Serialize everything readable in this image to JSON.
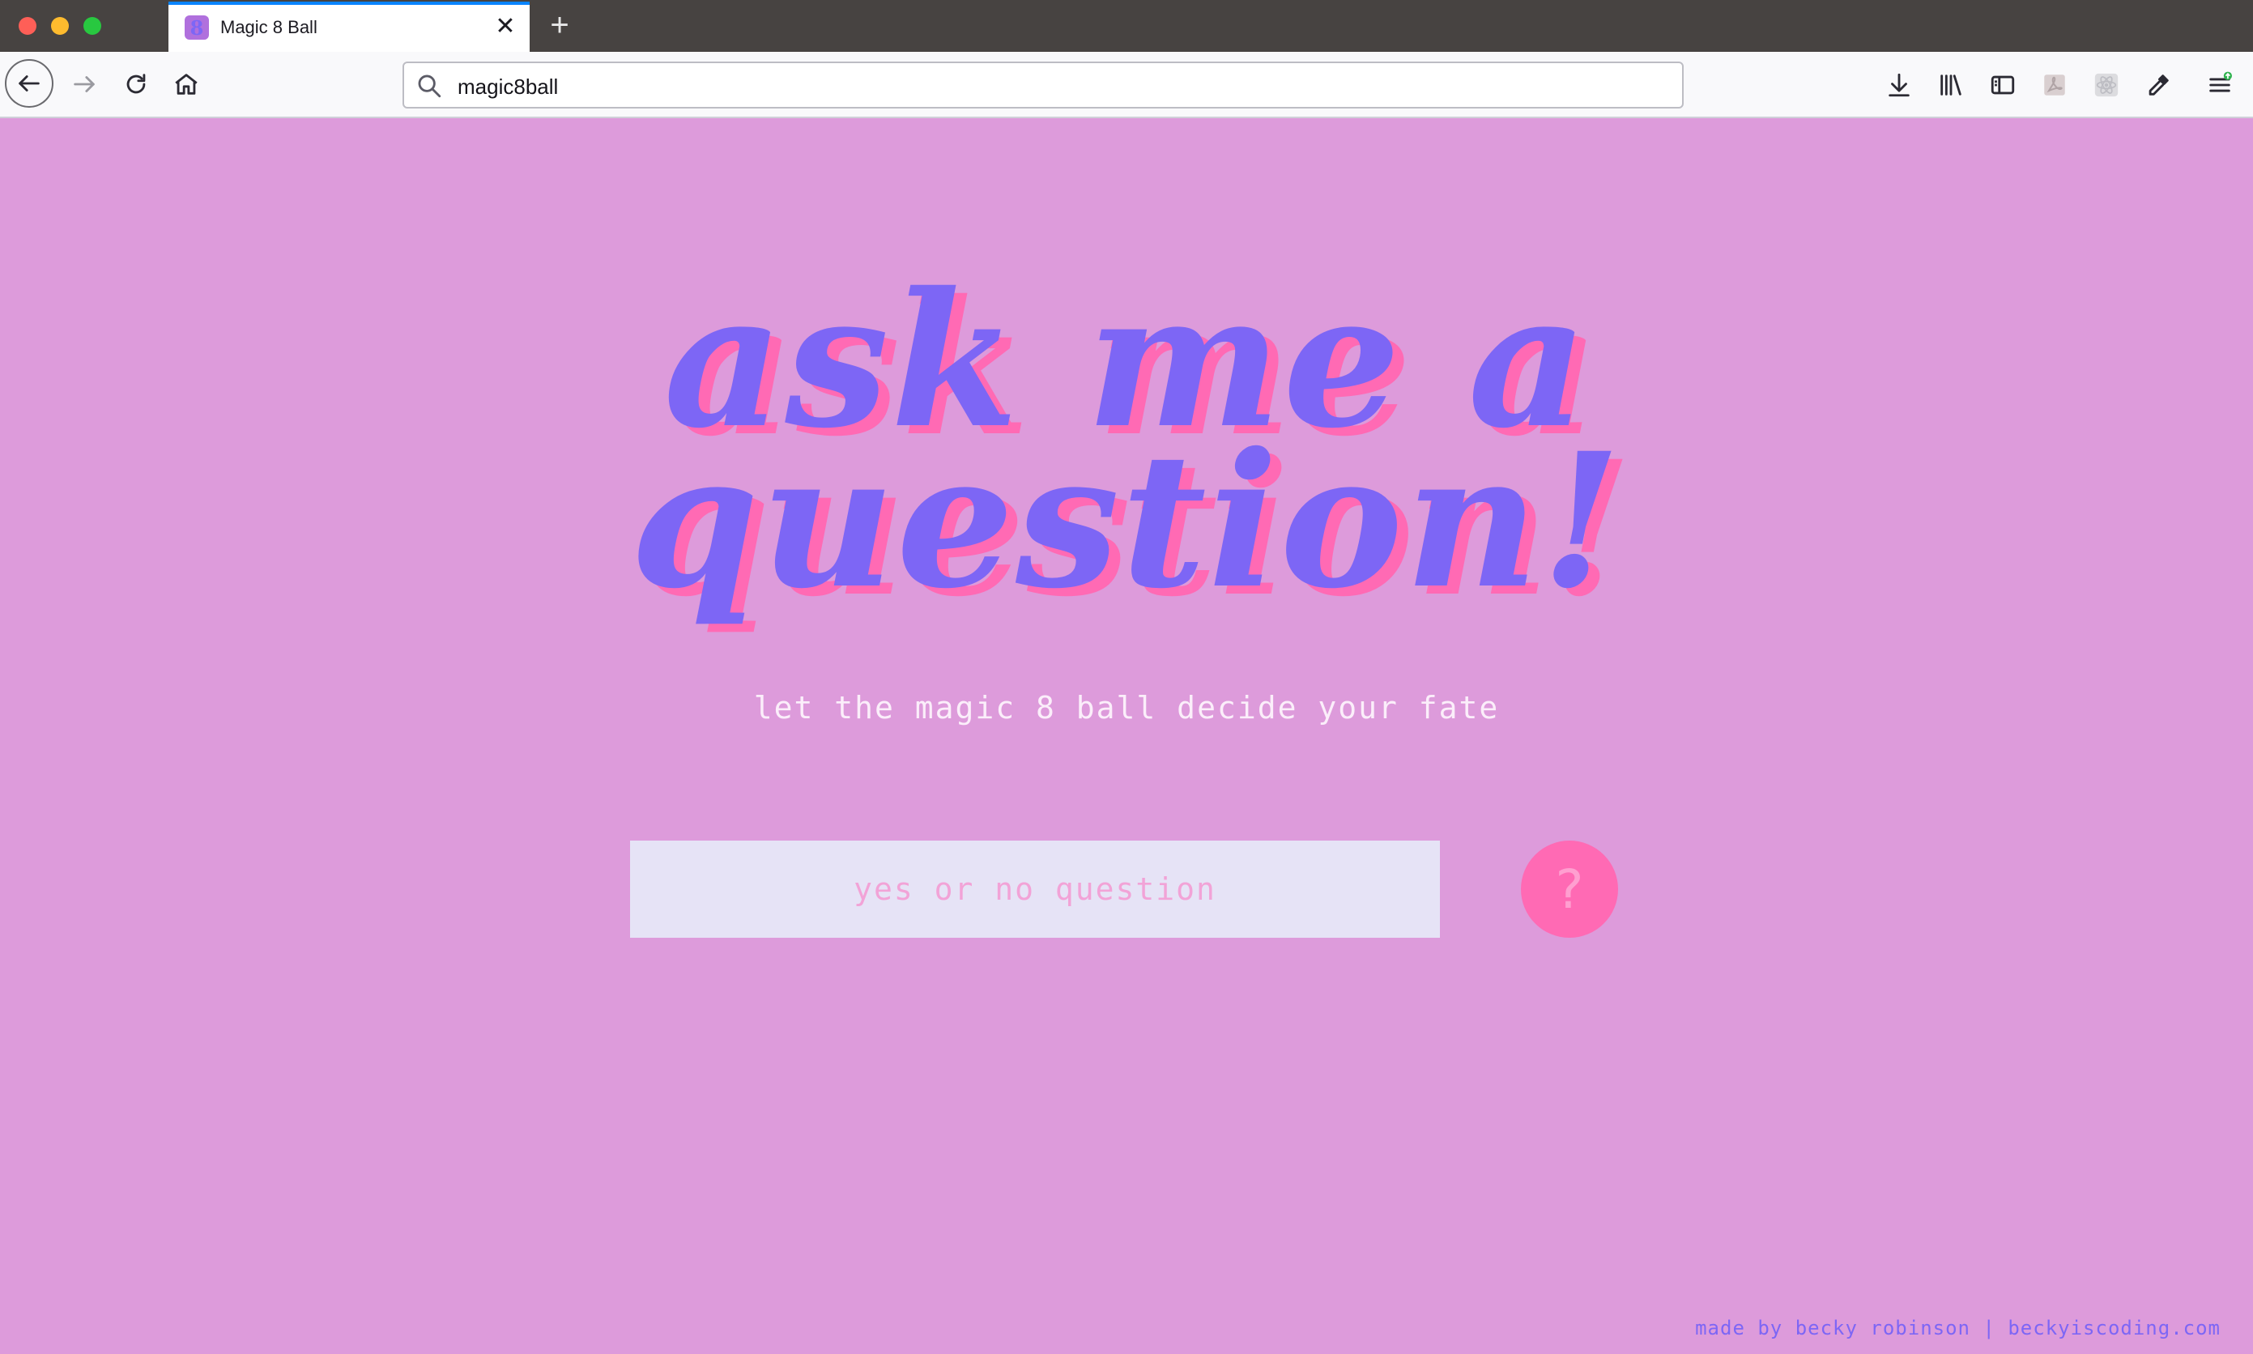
{
  "browser": {
    "tab": {
      "title": "Magic 8 Ball",
      "favicon_glyph": "8"
    },
    "new_tab_glyph": "+",
    "close_glyph": "✕",
    "url": "magic8ball"
  },
  "page": {
    "headline": "ask me a question!",
    "subtitle": "let the magic 8 ball decide your fate",
    "input_placeholder": "yes or no question",
    "ask_button_label": "?",
    "footer_author": "made by becky robinson",
    "footer_separator": "|",
    "footer_site": "beckyiscoding.com"
  },
  "colors": {
    "background": "#dd9bdb",
    "headline": "#7d66f5",
    "headline_shadow": "#ff6ab4",
    "button": "#ff6ab4",
    "input_background": "#e6e3f6",
    "footer": "#7d66f5"
  },
  "icons": {
    "toolbar": [
      "back-icon",
      "forward-icon",
      "reload-icon",
      "home-icon",
      "search-icon",
      "download-icon",
      "library-icon",
      "sidebar-icon",
      "pdf-icon",
      "react-devtools-icon",
      "eyedropper-icon",
      "menu-icon"
    ]
  }
}
